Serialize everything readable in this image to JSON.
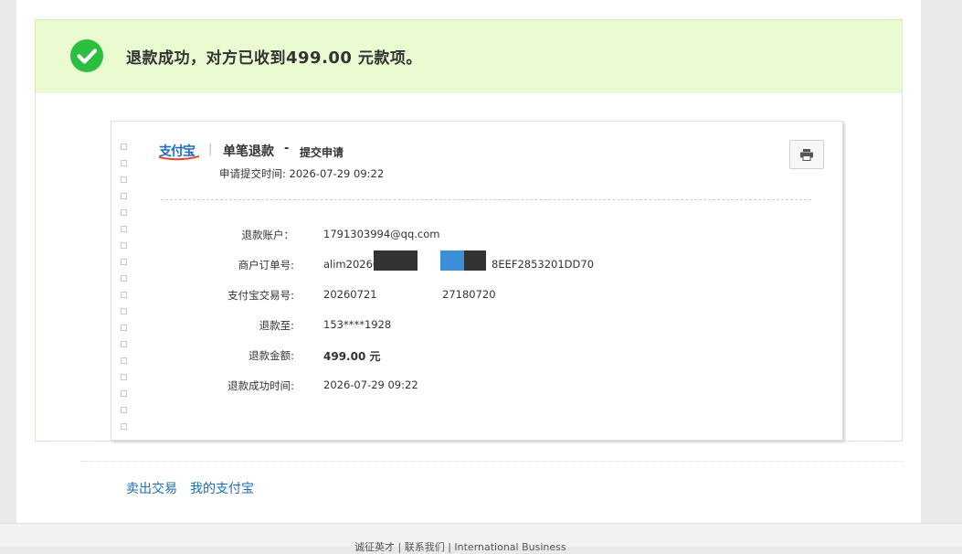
{
  "banner": {
    "message_prefix": "退款成功，对方已收到",
    "amount": "499.00",
    "message_suffix": " 元款项。",
    "status_color": "#2bbf3f"
  },
  "receipt": {
    "logo_text": "支付宝",
    "separator": "|",
    "title": "单笔退款",
    "dash": "-",
    "subtitle": "提交申请",
    "apply_time_label": "申请提交时间:",
    "apply_time": "2026-07-29 09:22",
    "print_icon": "printer-icon",
    "rows": [
      {
        "label": "退款账户：",
        "value": "1791303994@qq.com"
      },
      {
        "label": "商户订单号:",
        "value_prefix": "alim20260",
        "value_suffix": "8EEF2853201DD70"
      },
      {
        "label": "支付宝交易号:",
        "value_prefix": "20260721",
        "value_suffix": "27180720"
      },
      {
        "label": "退款至:",
        "value": "153****1928"
      },
      {
        "label": "退款金额:",
        "value": "499.00 元"
      },
      {
        "label": "退款成功时间:",
        "value": "2026-07-29 09:22"
      }
    ]
  },
  "links": {
    "sold_trades": "卖出交易",
    "my_alipay": "我的支付宝"
  },
  "footer": {
    "text": "诚征英才 | 联系我们 | International Business"
  }
}
